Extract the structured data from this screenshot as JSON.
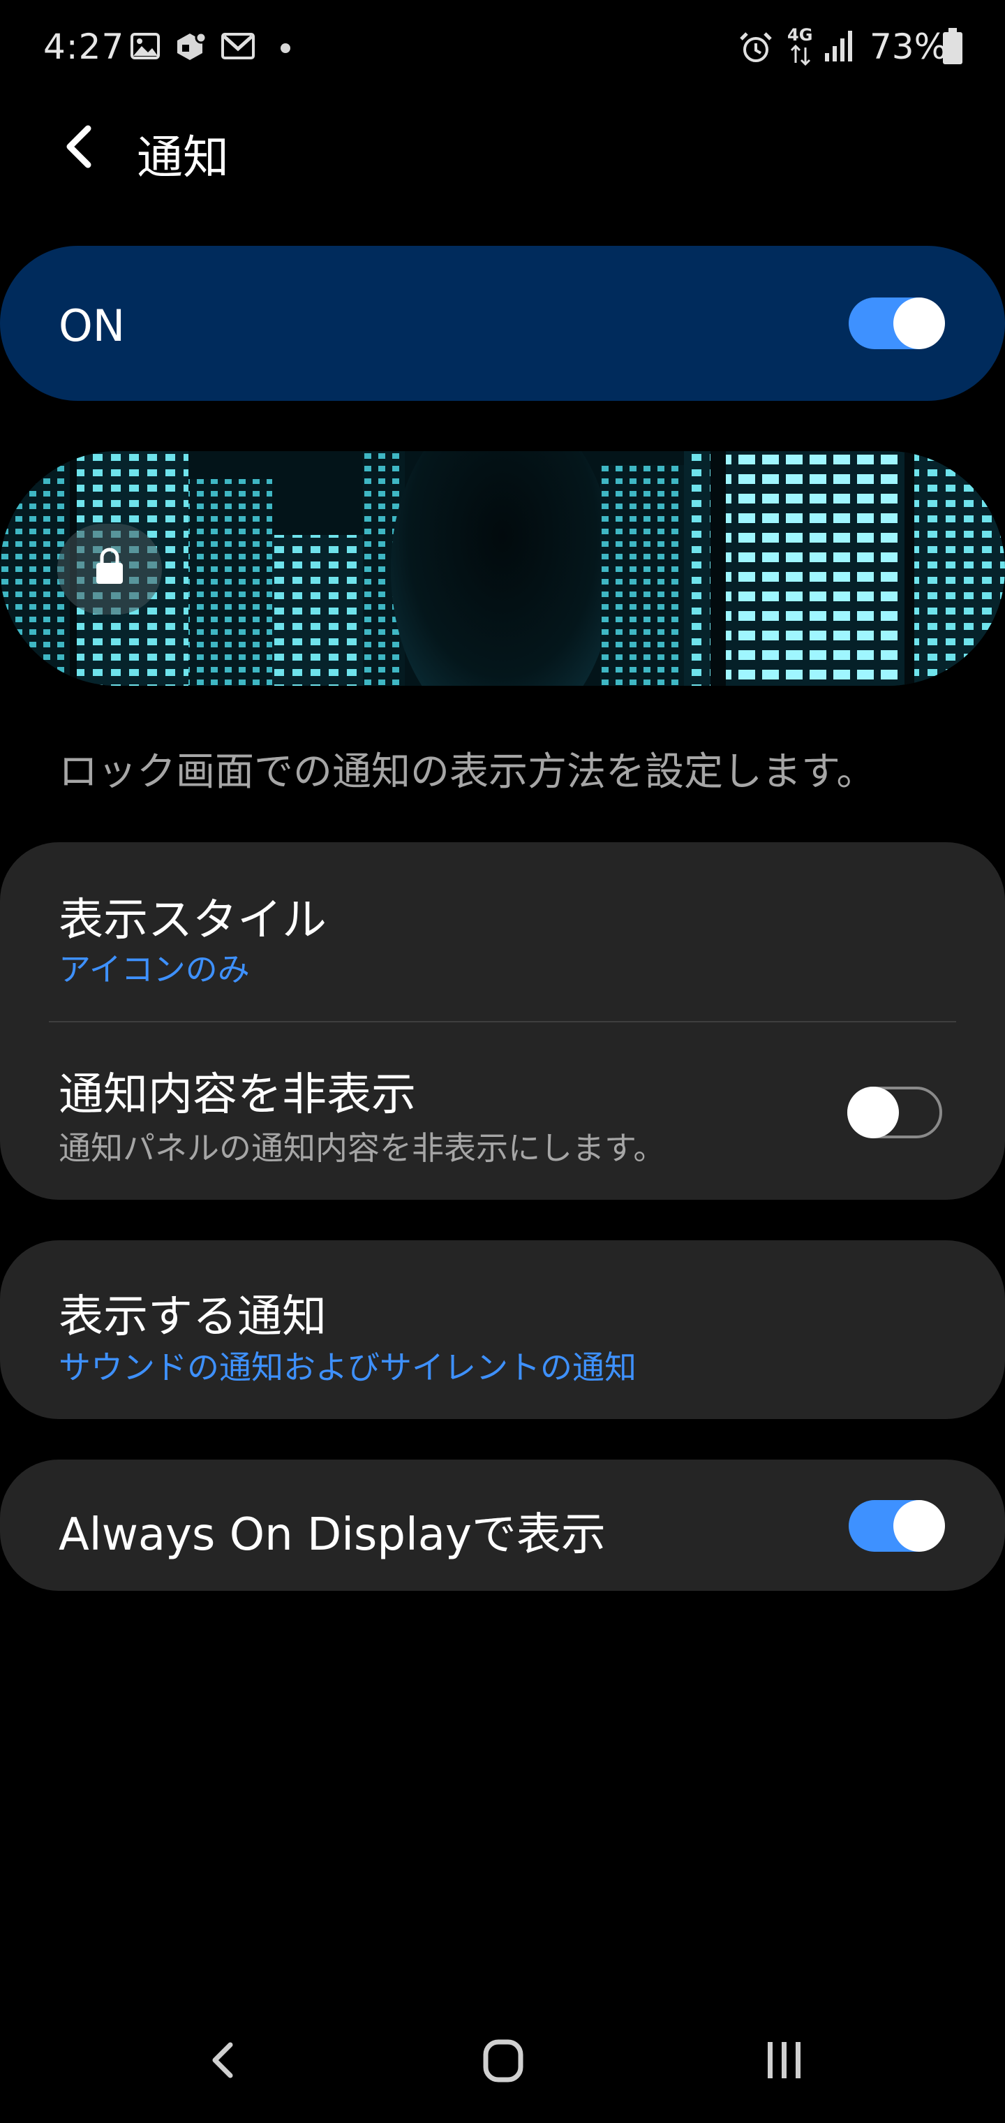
{
  "status_bar": {
    "time": "4:27",
    "battery": "73%",
    "network": "4G",
    "icons": [
      "gallery-icon",
      "app-notification-icon",
      "gmail-icon",
      "more-dot-icon",
      "alarm-icon",
      "network-4g-icon",
      "signal-icon",
      "battery-icon"
    ]
  },
  "header": {
    "back_icon": "back-arrow-icon",
    "title": "通知"
  },
  "master_switch": {
    "label": "ON",
    "enabled": true
  },
  "banner": {
    "icon": "lock-icon"
  },
  "description": "ロック画面での通知の表示方法を設定します。",
  "settings": {
    "display_style": {
      "title": "表示スタイル",
      "value": "アイコンのみ"
    },
    "hide_content": {
      "title": "通知内容を非表示",
      "summary": "通知パネルの通知内容を非表示にします。",
      "enabled": false
    },
    "notifications_to_show": {
      "title": "表示する通知",
      "value": "サウンドの通知およびサイレントの通知"
    },
    "always_on_display": {
      "title": "Always On Displayで表示",
      "enabled": true
    }
  },
  "nav_bar": {
    "icons": [
      "nav-back-icon",
      "nav-home-icon",
      "nav-recents-icon"
    ]
  },
  "colors": {
    "background": "#000000",
    "card": "#252525",
    "master_card": "#002b5c",
    "accent": "#3e91ff",
    "secondary_text": "#a6a6a6"
  }
}
